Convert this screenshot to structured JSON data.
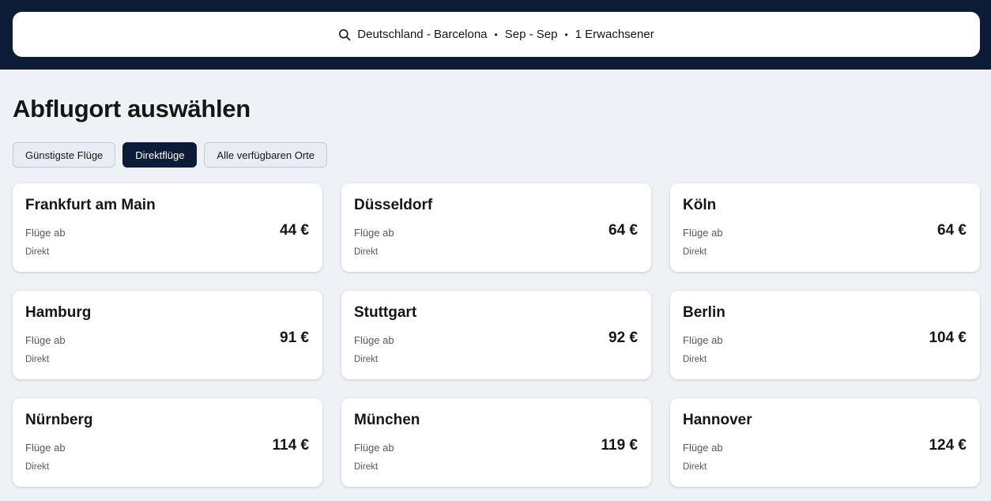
{
  "search": {
    "route": "Deutschland - Barcelona",
    "dates": "Sep - Sep",
    "passengers": "1 Erwachsener",
    "separator": "•"
  },
  "page_title": "Abflugort auswählen",
  "filters": [
    {
      "label": "Günstigste Flüge",
      "active": false
    },
    {
      "label": "Direktflüge",
      "active": true
    },
    {
      "label": "Alle verfügbaren Orte",
      "active": false
    }
  ],
  "cards": [
    {
      "city": "Frankfurt am Main",
      "sub": "Flüge ab",
      "stops": "Direkt",
      "price": "44 €"
    },
    {
      "city": "Düsseldorf",
      "sub": "Flüge ab",
      "stops": "Direkt",
      "price": "64 €"
    },
    {
      "city": "Köln",
      "sub": "Flüge ab",
      "stops": "Direkt",
      "price": "64 €"
    },
    {
      "city": "Hamburg",
      "sub": "Flüge ab",
      "stops": "Direkt",
      "price": "91 €"
    },
    {
      "city": "Stuttgart",
      "sub": "Flüge ab",
      "stops": "Direkt",
      "price": "92 €"
    },
    {
      "city": "Berlin",
      "sub": "Flüge ab",
      "stops": "Direkt",
      "price": "104 €"
    },
    {
      "city": "Nürnberg",
      "sub": "Flüge ab",
      "stops": "Direkt",
      "price": "114 €"
    },
    {
      "city": "München",
      "sub": "Flüge ab",
      "stops": "Direkt",
      "price": "119 €"
    },
    {
      "city": "Hannover",
      "sub": "Flüge ab",
      "stops": "Direkt",
      "price": "124 €"
    }
  ],
  "colors": {
    "header_bg": "#0c1b36",
    "page_bg": "#eef1f5",
    "active_chip": "#0c1b36"
  },
  "icons": {
    "search": "search-icon"
  }
}
